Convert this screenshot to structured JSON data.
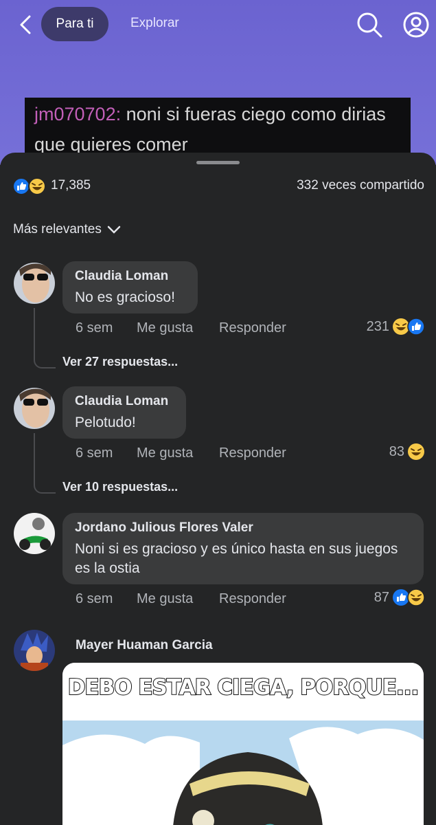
{
  "nav": {
    "tab_active": "Para ti",
    "tab_other": "Explorar"
  },
  "video_caption": {
    "user": "jm070702:",
    "text": " noni si fueras ciego como dirias que quieres comer"
  },
  "post_stats": {
    "reactions": "17,385",
    "shares": "332 veces compartido"
  },
  "sort": {
    "label": "Más relevantes"
  },
  "actions": {
    "like": "Me gusta",
    "reply": "Responder"
  },
  "comments": [
    {
      "name": "Claudia Loman",
      "text": "No es gracioso!",
      "time": "6 sem",
      "reactions": "231",
      "replies": "Ver 27 respuestas..."
    },
    {
      "name": "Claudia Loman",
      "text": "Pelotudo!",
      "time": "6 sem",
      "reactions": "83",
      "replies": "Ver 10 respuestas..."
    },
    {
      "name": "Jordano Julious Flores Valer",
      "text": "Noni si es gracioso y es único hasta en sus juegos es la ostia",
      "time": "6 sem",
      "reactions": "87"
    },
    {
      "name": "Mayer Huaman Garcia",
      "image_text": "DEBO ESTAR CIEGA, PORQUE..."
    }
  ],
  "colors": {
    "background": "#242526",
    "bubble": "#3a3b3c",
    "like_blue": "#1877f2",
    "haha_yellow": "#f7c948",
    "header_purple": "#6b63d0"
  }
}
